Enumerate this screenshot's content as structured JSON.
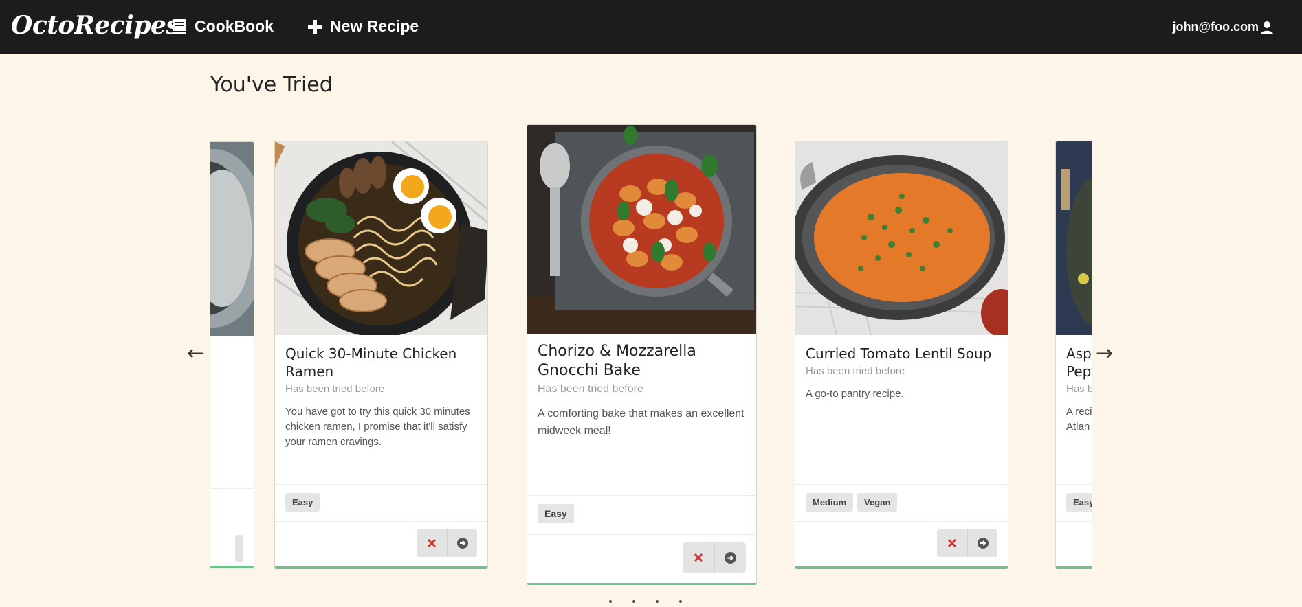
{
  "nav": {
    "brand": "OctoRecipes",
    "cookbook_label": "CookBook",
    "cookbook_icon": "book-icon",
    "new_recipe_label": "New Recipe",
    "new_recipe_icon": "plus-icon",
    "user_label": "john@foo.com",
    "user_icon": "user-icon"
  },
  "page": {
    "title": "You've Tried",
    "prev_arrow": "←",
    "next_arrow": "→"
  },
  "cards": [
    {
      "title": "",
      "subtitle": "",
      "description": "",
      "tags": [],
      "visible": "partial-left"
    },
    {
      "title": "Quick 30-Minute Chicken Ramen",
      "subtitle": "Has been tried before",
      "description": "You have got to try this quick 30 minutes chicken ramen, I promise that it'll satisfy your ramen cravings.",
      "tags": [
        "Easy"
      ]
    },
    {
      "title": "Chorizo & Mozzarella Gnocchi Bake",
      "subtitle": "Has been tried before",
      "description": "A comforting bake that makes an excellent midweek meal!",
      "tags": [
        "Easy"
      ],
      "active": true
    },
    {
      "title": "Curried Tomato Lentil Soup",
      "subtitle": "Has been tried before",
      "description": "A go-to pantry recipe.",
      "tags": [
        "Medium",
        "Vegan"
      ]
    },
    {
      "title": "Aspa... Pepp...",
      "title_visible_1": "Aspa",
      "title_visible_2": "Pepp",
      "subtitle": "Has b",
      "description_line_1": "A reci",
      "description_line_2": "Atlan",
      "tags": [
        "Easy"
      ],
      "visible": "partial-right"
    }
  ],
  "colors": {
    "navbar": "#1c1c1d",
    "background": "#fdf5e8",
    "card_accent": "#6cc28a",
    "remove_icon": "#d9302c",
    "open_icon": "#555555"
  }
}
